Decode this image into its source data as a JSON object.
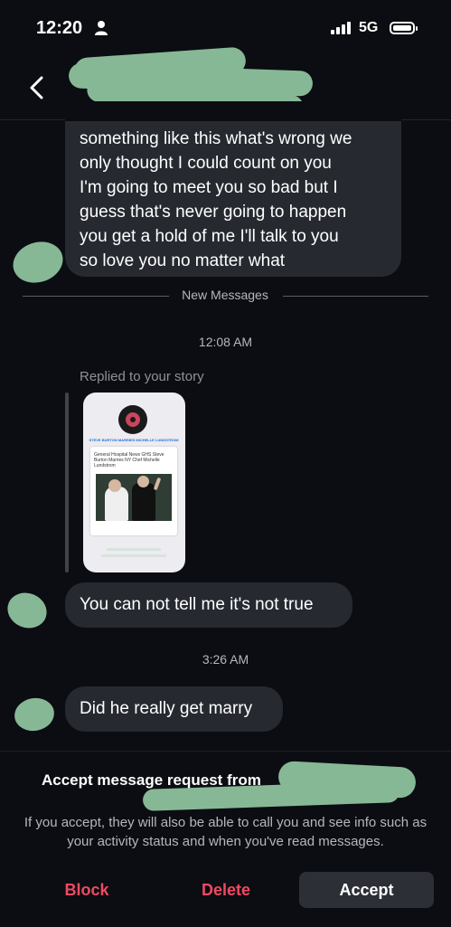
{
  "status_bar": {
    "time": "12:20",
    "network": "5G"
  },
  "conversation": {
    "long_message": [
      "something like this what's wrong we",
      "only thought I could count on you",
      "I'm going to meet you so bad but I",
      "guess that's never going to happen",
      "you get a hold of me I'll talk to you",
      "so love you no matter what"
    ],
    "new_messages_label": "New Messages",
    "timestamp_1": "12:08 AM",
    "replied_label": "Replied to your story",
    "story": {
      "header": "STEVE BURTON MARRIES MICHELLE LUNDSTROM",
      "headline": "General Hospital News GHS Steve Burton Marries NY Chef Michelle Lundstrom"
    },
    "message_2": "You can not tell me it's not true",
    "timestamp_2": "3:26 AM",
    "message_3": "Did he really get marry"
  },
  "accept_panel": {
    "title": "Accept message request from",
    "description": "If you accept, they will also be able to call you and see info such as your activity status and when you've read messages.",
    "block_label": "Block",
    "delete_label": "Delete",
    "accept_label": "Accept"
  },
  "colors": {
    "background": "#0b0d12",
    "bubble": "#262930",
    "danger": "#ee4a62",
    "accept_bg": "#2c2f36"
  }
}
